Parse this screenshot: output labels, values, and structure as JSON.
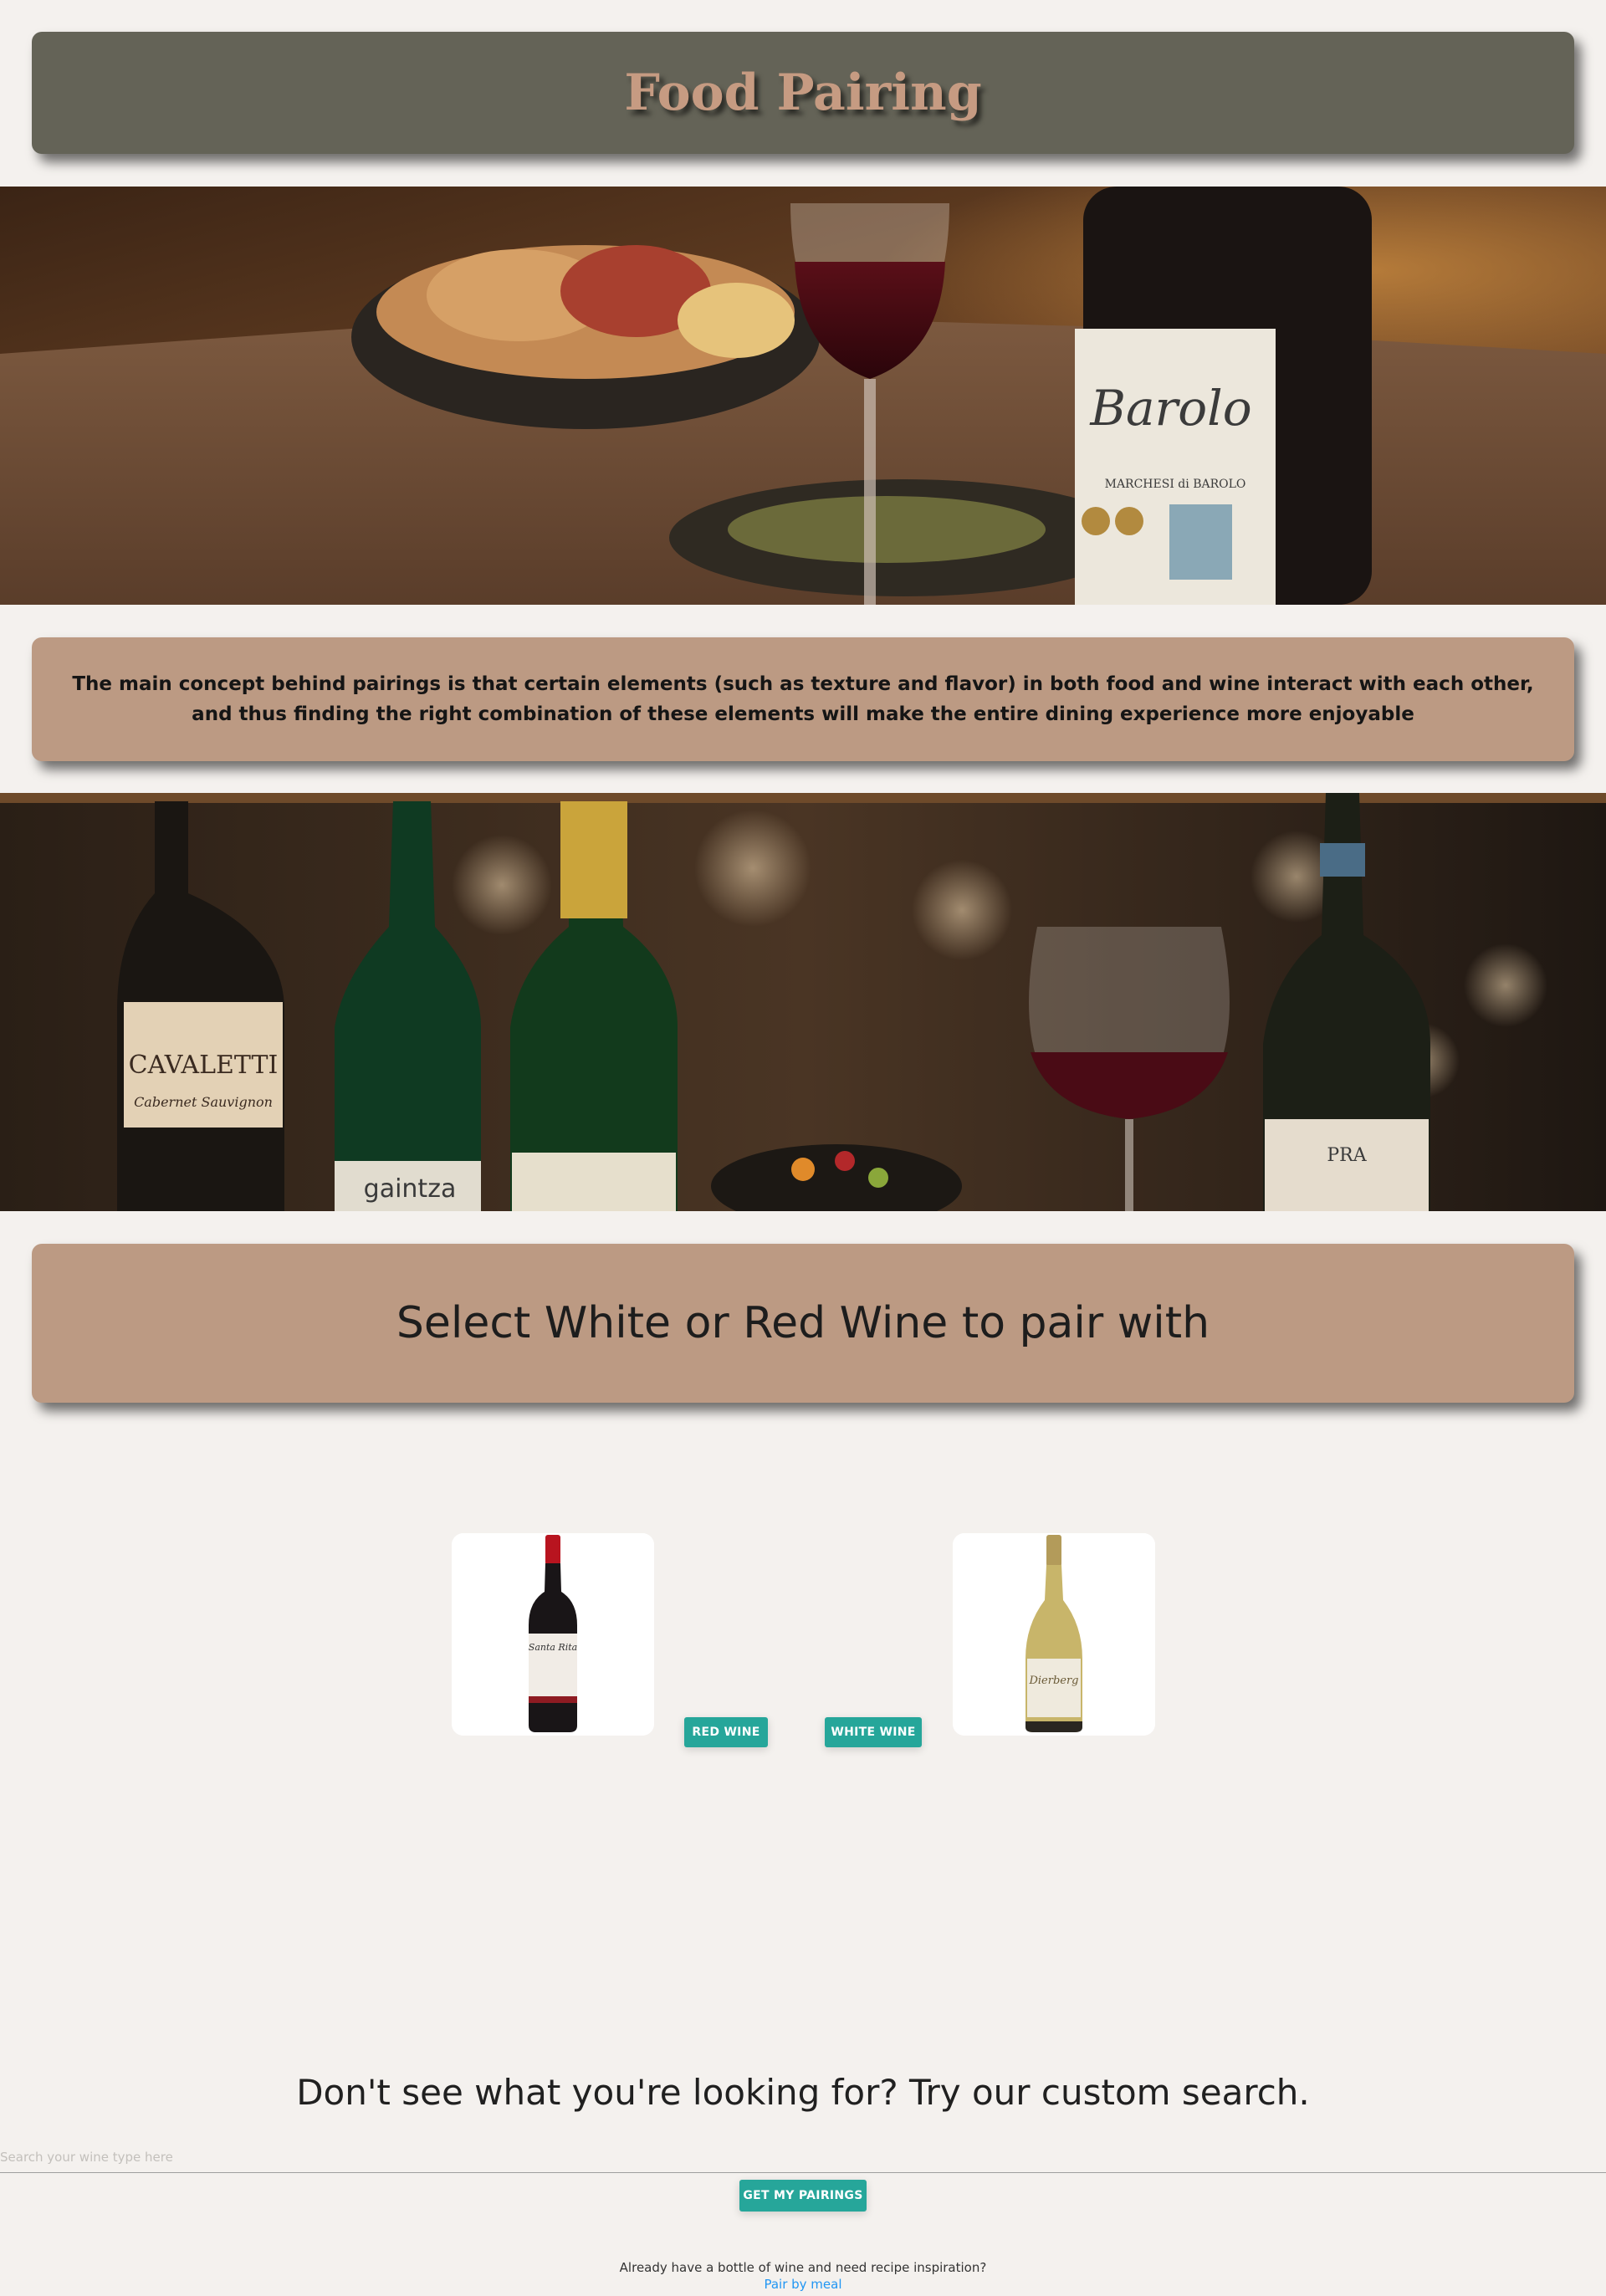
{
  "header": {
    "title": "Food Pairing"
  },
  "intro": {
    "text": "The main concept behind pairings is that certain elements (such as texture and flavor) in both food and wine interact with each other, and thus finding the right combination of these elements will make the entire dining experience more enjoyable"
  },
  "banner_top": {
    "bottle_label": "Barolo",
    "bottle_sublabel": "MARCHESI di BAROLO"
  },
  "banner_bottom": {
    "bottle_1_label": "CAVALETTI",
    "bottle_1_sub": "Cabernet Sauvignon",
    "bottle_2_label": "gaintza",
    "bottle_5_label": "PRA"
  },
  "selection": {
    "heading": "Select White or Red Wine to pair with",
    "red_button": "RED WINE",
    "white_button": "WHITE WINE"
  },
  "custom_search": {
    "heading": "Don't see what you're looking for? Try our custom search.",
    "placeholder": "Search your wine type here",
    "value": "",
    "submit_label": "GET MY PAIRINGS"
  },
  "footer": {
    "text": "Already have a bottle of wine and need recipe inspiration?",
    "link_label": "Pair by meal"
  },
  "colors": {
    "background": "#f4f1ee",
    "header_bg": "#646357",
    "header_text": "#c69b82",
    "card_bg": "#bc9a83",
    "button": "#26a69a",
    "link": "#2196f3"
  }
}
